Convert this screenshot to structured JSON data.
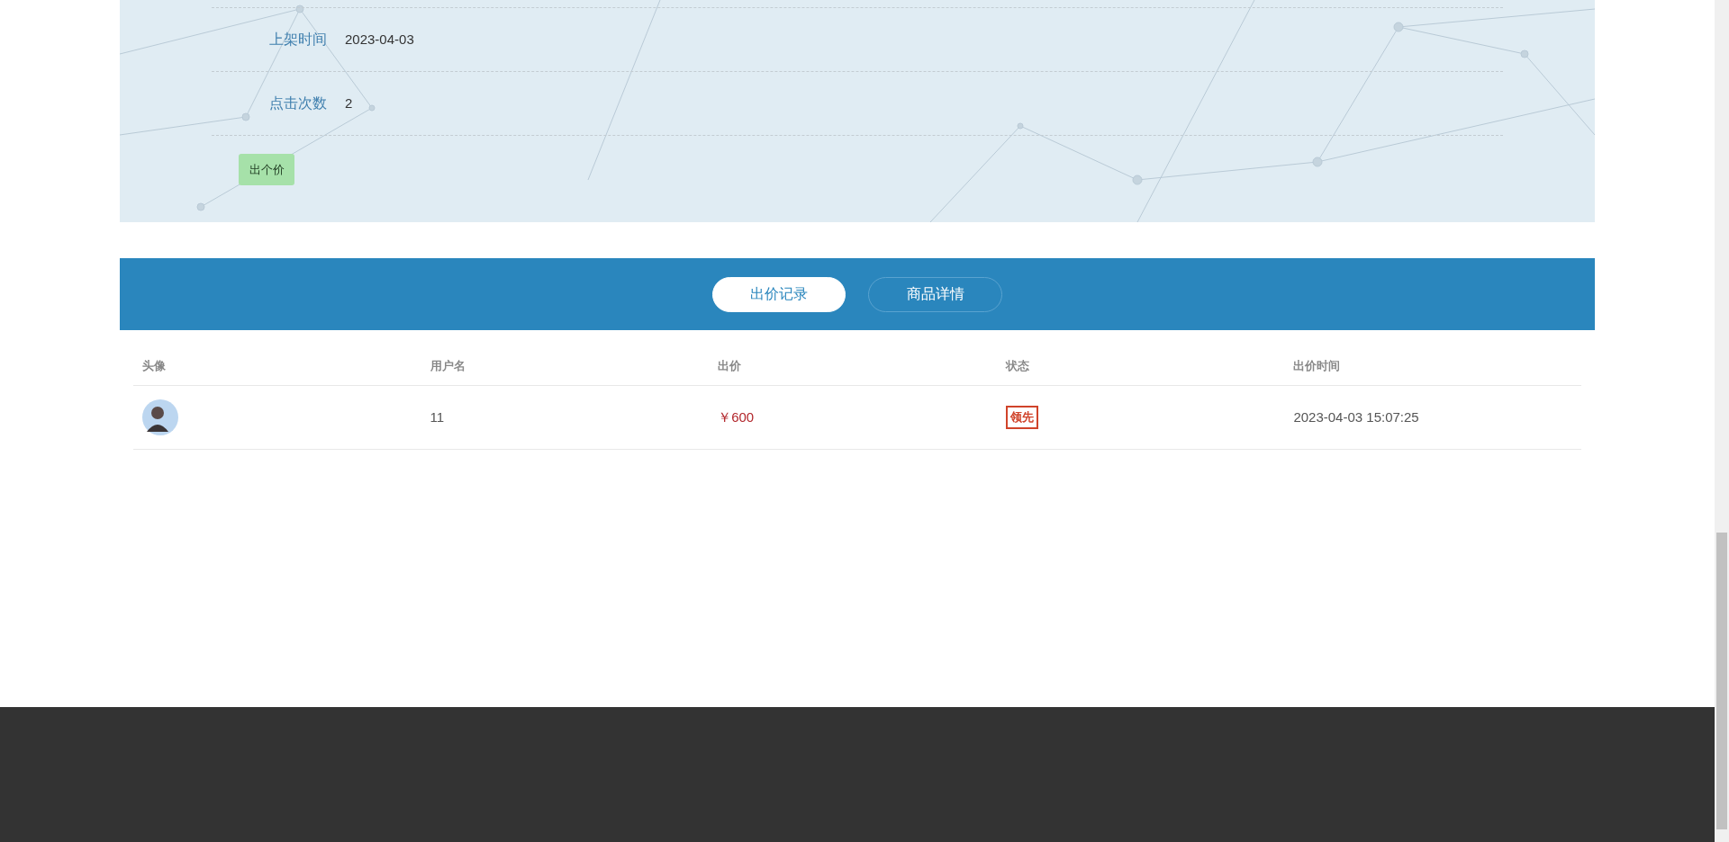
{
  "info_rows": [
    {
      "label": "上架时间",
      "value": "2023-04-03"
    },
    {
      "label": "点击次数",
      "value": "2"
    }
  ],
  "bid_button": "出个价",
  "tabs": [
    {
      "label": "出价记录",
      "selected": true
    },
    {
      "label": "商品详情",
      "selected": false
    }
  ],
  "table": {
    "columns": [
      "头像",
      "用户名",
      "出价",
      "状态",
      "出价时间"
    ],
    "rows": [
      {
        "username": "11",
        "price": "￥600",
        "status": "领先",
        "time": "2023-04-03 15:07:25"
      }
    ]
  }
}
